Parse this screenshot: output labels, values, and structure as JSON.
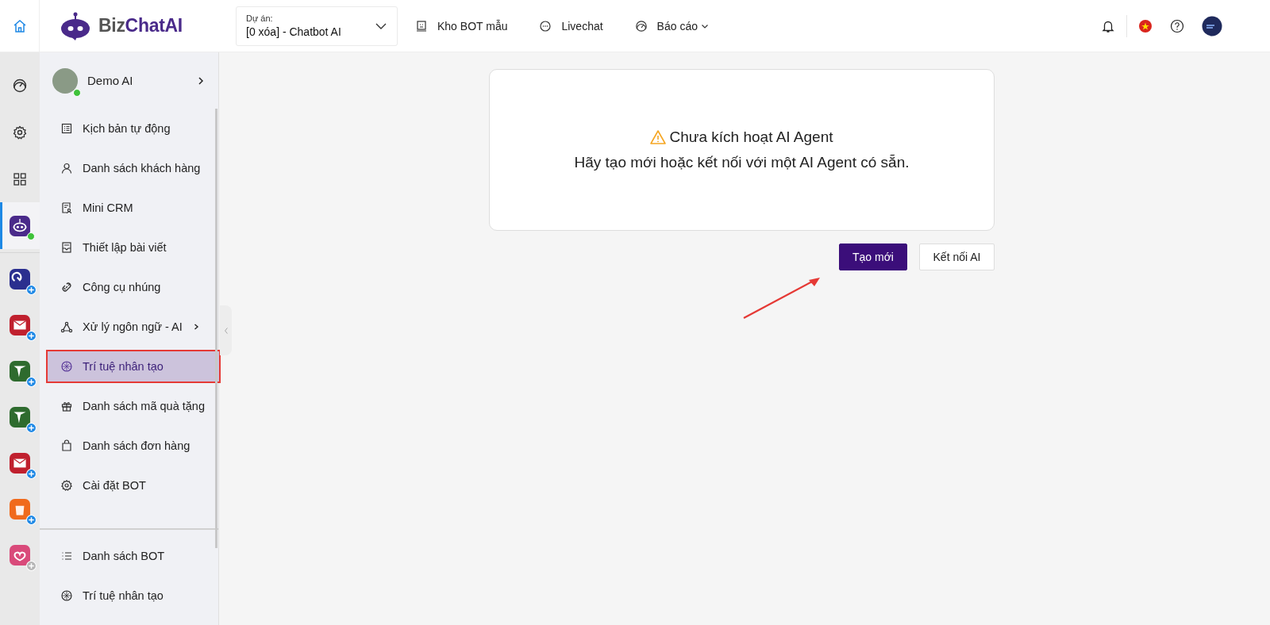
{
  "brand": {
    "name_part1": "Biz",
    "name_part2": "ChatAI"
  },
  "project": {
    "label": "Dự án:",
    "value": "[0 xóa] - Chatbot AI"
  },
  "nav": [
    {
      "label": "Kho BOT mẫu",
      "has_dropdown": false
    },
    {
      "label": "Livechat",
      "has_dropdown": false
    },
    {
      "label": "Báo cáo",
      "has_dropdown": true
    }
  ],
  "rail": {
    "tools": [
      {
        "selected": false
      },
      {
        "selected": false
      },
      {
        "selected": false
      },
      {
        "selected": true,
        "online": true
      }
    ],
    "apps": [
      {
        "color": "#2b2f8f",
        "badge_active": true
      },
      {
        "color": "#c0202e",
        "badge_active": true
      },
      {
        "color": "#2e6b2e",
        "badge_active": true
      },
      {
        "color": "#2e6b2e",
        "badge_active": true
      },
      {
        "color": "#c0202e",
        "badge_active": true
      },
      {
        "color": "#f06a1c",
        "badge_active": true
      },
      {
        "color": "#d94a7a",
        "badge_active": false
      }
    ]
  },
  "bot": {
    "name": "Demo AI",
    "online": true
  },
  "menu": [
    {
      "label": "Kịch bản tự động",
      "selected": false,
      "has_submenu": false
    },
    {
      "label": "Danh sách khách hàng",
      "selected": false,
      "has_submenu": false
    },
    {
      "label": "Mini CRM",
      "selected": false,
      "has_submenu": false
    },
    {
      "label": "Thiết lập bài viết",
      "selected": false,
      "has_submenu": false
    },
    {
      "label": "Công cụ nhúng",
      "selected": false,
      "has_submenu": false
    },
    {
      "label": "Xử lý ngôn ngữ - AI",
      "selected": false,
      "has_submenu": true
    },
    {
      "label": "Trí tuệ nhân tạo",
      "selected": true,
      "has_submenu": false
    },
    {
      "label": "Danh sách mã quà tặng",
      "selected": false,
      "has_submenu": false
    },
    {
      "label": "Danh sách đơn hàng",
      "selected": false,
      "has_submenu": false
    },
    {
      "label": "Cài đặt BOT",
      "selected": false,
      "has_submenu": false
    }
  ],
  "menu_bottom": [
    {
      "label": "Danh sách BOT",
      "selected": false
    },
    {
      "label": "Trí tuệ nhân tạo",
      "selected": false
    }
  ],
  "notice": {
    "title": "Chưa kích hoạt AI Agent",
    "message": "Hãy tạo mới hoặc kết nối với một AI Agent có sẵn."
  },
  "actions": [
    {
      "label": "Tạo mới",
      "kind": "primary"
    },
    {
      "label": "Kết nối AI",
      "kind": "secondary"
    }
  ]
}
